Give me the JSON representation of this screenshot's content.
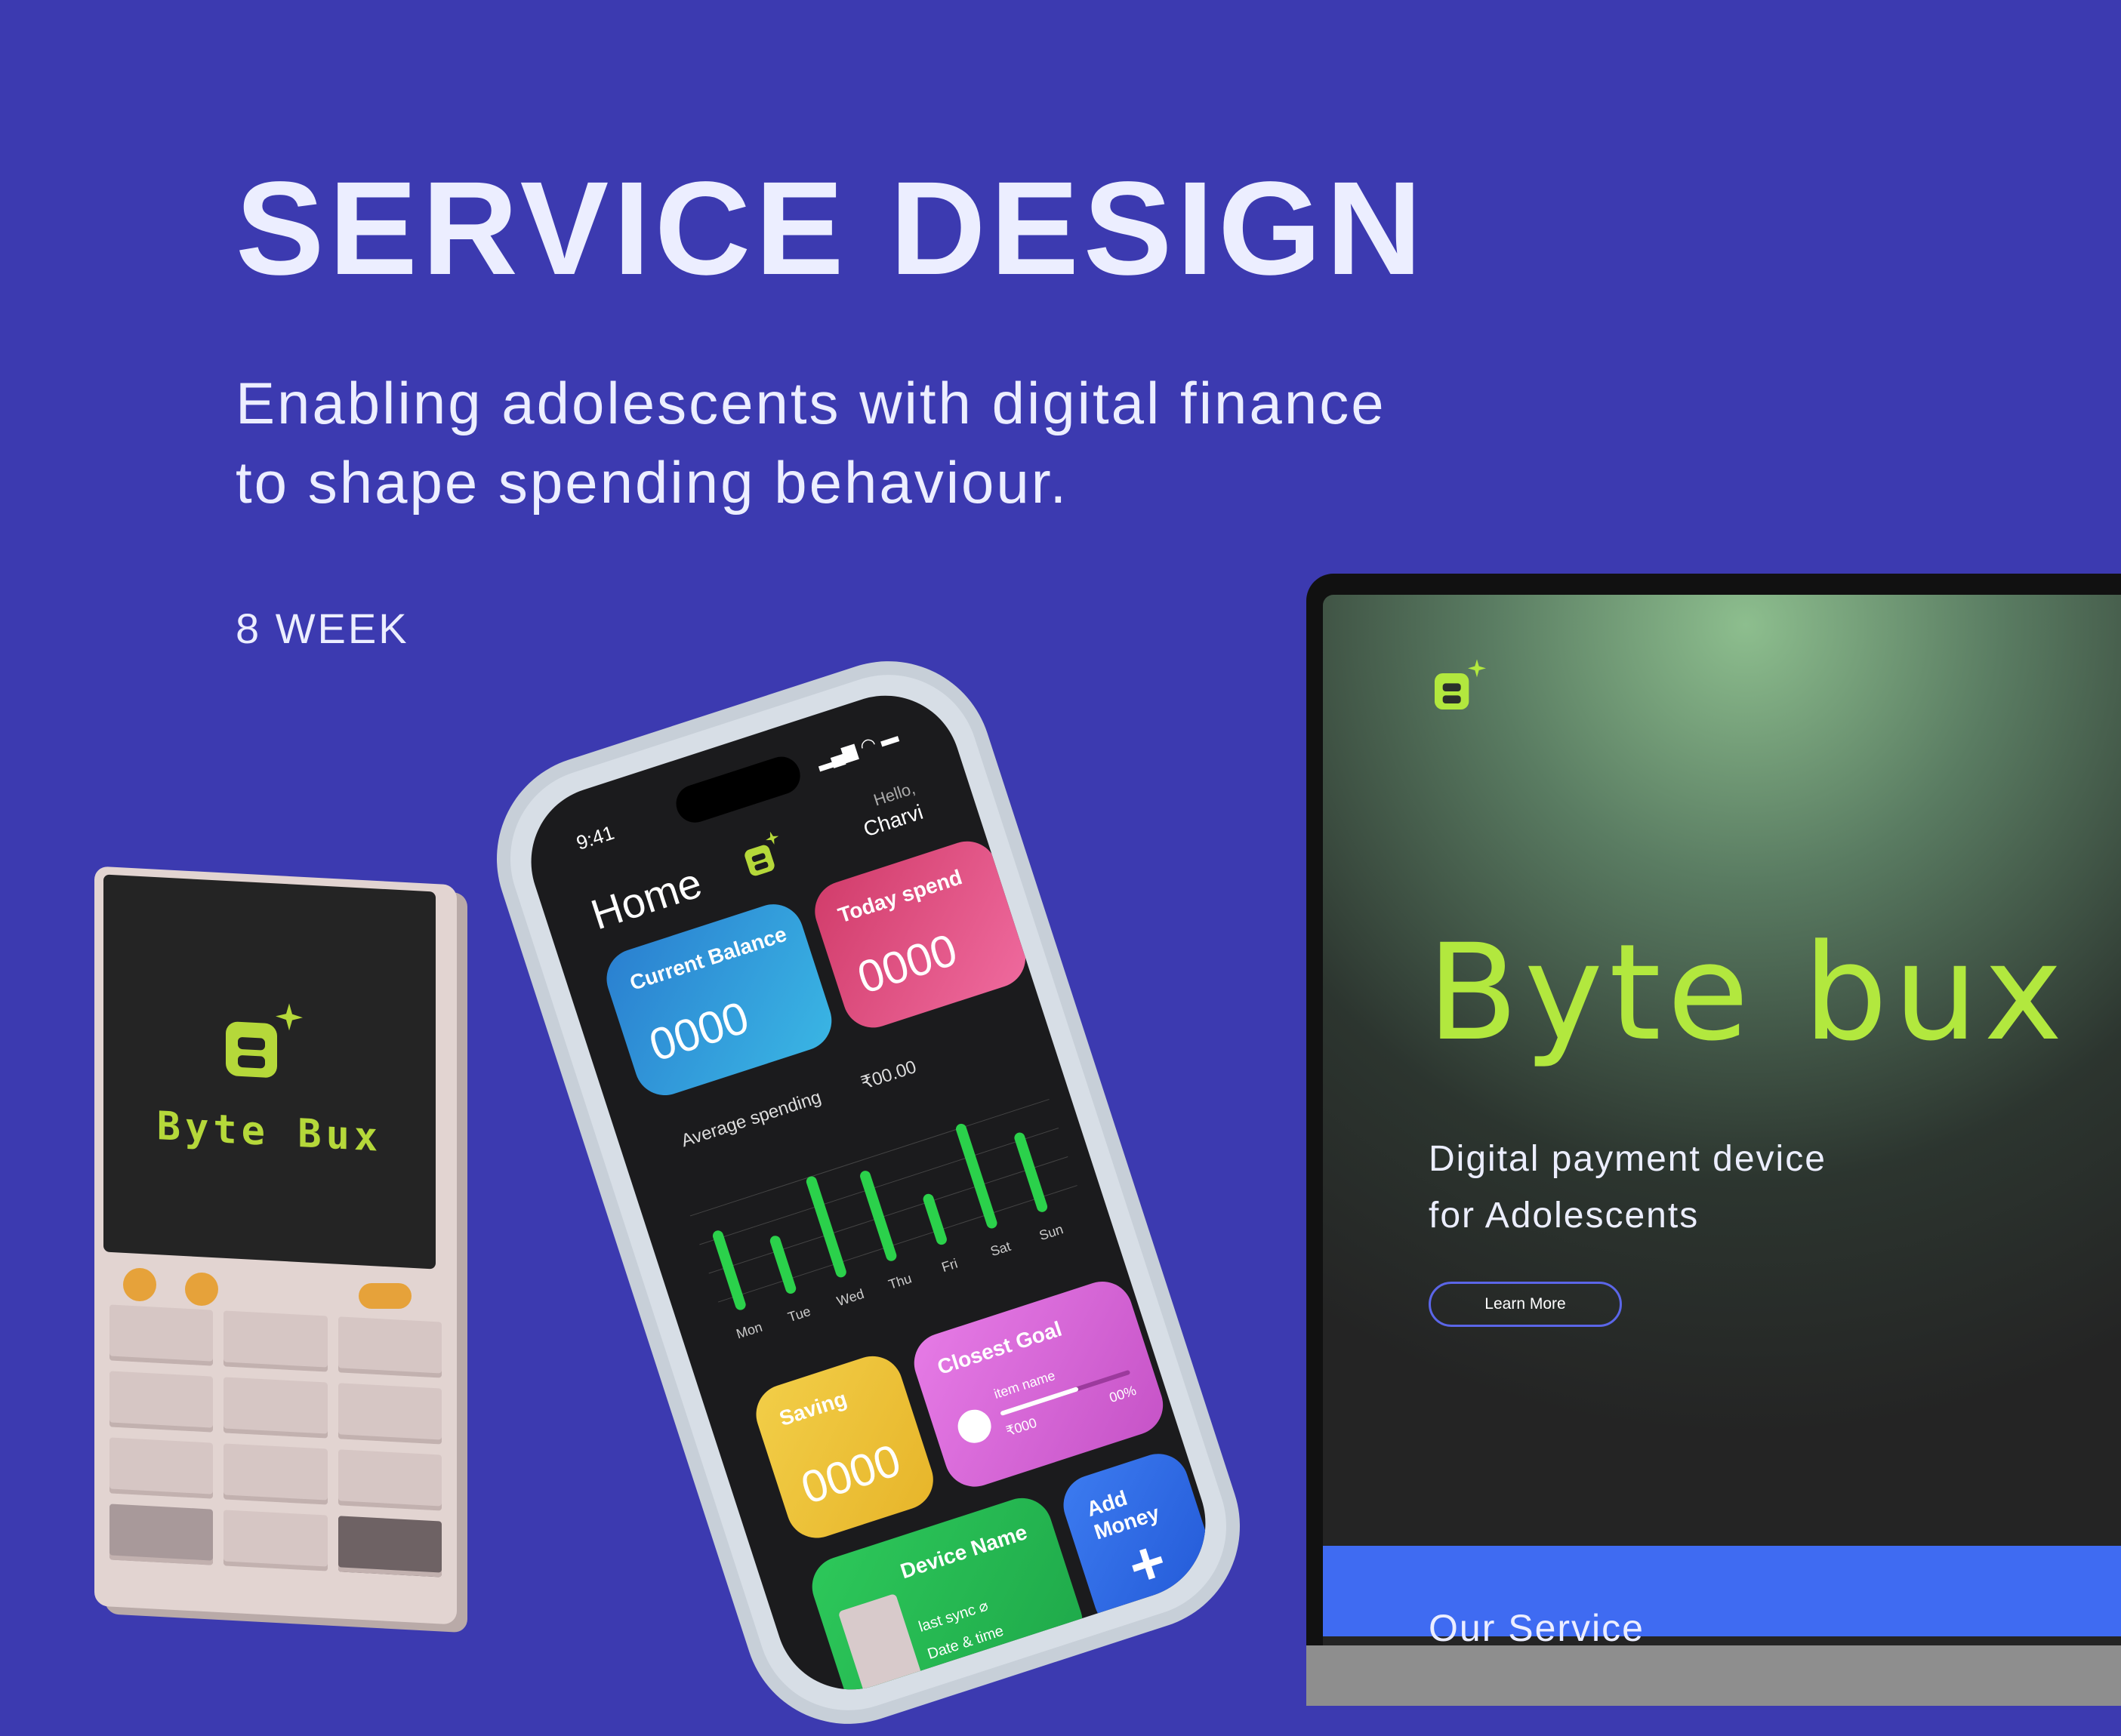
{
  "headline": "SERVICE DESIGN",
  "subtitle": {
    "line1": "Enabling adolescents with digital finance",
    "line2": "to shape spending behaviour."
  },
  "duration": "8 WEEK",
  "device": {
    "brand": "Byte Bux"
  },
  "phone": {
    "time": "9:41",
    "title": "Home",
    "greeting": "Hello,",
    "user": "Charvi",
    "current_balance": {
      "label": "Current Balance",
      "value": "0000"
    },
    "today_spend": {
      "label": "Today spend",
      "value": "0000"
    },
    "average_spending": {
      "label": "Average spending",
      "value": "₹00.00"
    },
    "days": [
      "Mon",
      "Tue",
      "Wed",
      "Thu",
      "Fri",
      "Sat",
      "Sun"
    ],
    "saving": {
      "label": "Saving",
      "value": "0000"
    },
    "closest_goal": {
      "label": "Closest Goal",
      "item": "item name",
      "amount": "₹000",
      "percent": "00%"
    },
    "device_card": {
      "label": "Device Name",
      "sync": "last sync ⌀",
      "datetime": "Date & time"
    },
    "add_money": {
      "label": "Add Money",
      "icon": "+"
    }
  },
  "laptop": {
    "brand": "Byte bux",
    "tagline1": "Digital payment device",
    "tagline2": "for Adolescents",
    "cta": "Learn More",
    "section": "Our Service"
  },
  "colors": {
    "background": "#3C3AB0",
    "accent_green": "#B2E83E",
    "balance_card": "#2E98D8",
    "spend_card": "#E0487E",
    "saving_card": "#F0C73A",
    "goal_card": "#D565D9",
    "device_card": "#2FCB5A",
    "add_money_card": "#2F6BE6"
  }
}
